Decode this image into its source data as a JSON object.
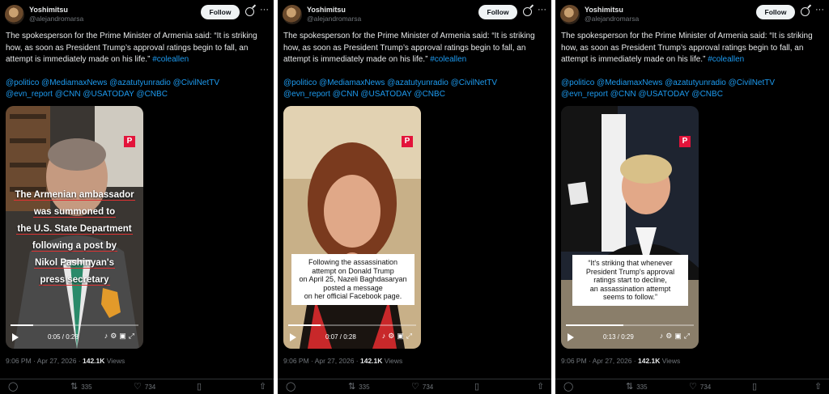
{
  "tweets": [
    {
      "author": {
        "name": "Yoshimitsu",
        "handle": "@alejandromarsa"
      },
      "follow_label": "Follow",
      "text": "The spokesperson for the Prime Minister of Armenia said: “It is striking how, as soon as President Trump’s approval ratings begin to fall, an attempt is immediately made on his life.”",
      "hashtag": "#coleallen",
      "mentions_line1": "@politico @MediamaxNews @azatutyunradio @CivilNetTV",
      "mentions_line2": "@evn_report @CNN @USATODAY @CNBC",
      "video": {
        "badge": "P",
        "caption_lines": [
          "The Armenian ambassador",
          "was summoned to",
          "the U.S. State Department",
          "following a post by",
          "Nikol Pashinyan's",
          "press secretary"
        ],
        "time": "0:05 / 0:28",
        "progress": 0.18
      },
      "timestamp": "9:06 PM · Apr 27, 2026 ·",
      "views_count": "142.1K",
      "views_label": "Views",
      "retweets": "335",
      "likes": "734"
    },
    {
      "author": {
        "name": "Yoshimitsu",
        "handle": "@alejandromarsa"
      },
      "follow_label": "Follow",
      "text": "The spokesperson for the Prime Minister of Armenia said: “It is striking how, as soon as President Trump’s approval ratings begin to fall, an attempt is immediately made on his life.”",
      "hashtag": "#coleallen",
      "mentions_line1": "@politico @MediamaxNews @azatutyunradio @CivilNetTV",
      "mentions_line2": "@evn_report @CNN @USATODAY @CNBC",
      "video": {
        "badge": "P",
        "caption_lines": [
          "Following the assassination",
          "attempt on Donald Trump",
          "on April 25, Nazeli Baghdasaryan",
          "posted a message",
          "on her official Facebook page."
        ],
        "time": "0:07 / 0:28",
        "progress": 0.25
      },
      "timestamp": "9:06 PM · Apr 27, 2026 ·",
      "views_count": "142.1K",
      "views_label": "Views",
      "retweets": "335",
      "likes": "734"
    },
    {
      "author": {
        "name": "Yoshimitsu",
        "handle": "@alejandromarsa"
      },
      "follow_label": "Follow",
      "text": "The spokesperson for the Prime Minister of Armenia said: “It is striking how, as soon as President Trump’s approval ratings begin to fall, an attempt is immediately made on his life.”",
      "hashtag": "#coleallen",
      "mentions_line1": "@politico @MediamaxNews @azatutyunradio @CivilNetTV",
      "mentions_line2": "@evn_report @CNN @USATODAY @CNBC",
      "video": {
        "badge": "P",
        "caption_lines": [
          "“It's striking that whenever",
          "President Trump's approval",
          "ratings start to decline,",
          "an assassination attempt",
          "seems to follow.”"
        ],
        "time": "0:13 / 0:29",
        "progress": 0.45
      },
      "timestamp": "9:06 PM · Apr 27, 2026 ·",
      "views_count": "142.1K",
      "views_label": "Views",
      "retweets": "335",
      "likes": "734"
    }
  ],
  "colors": {
    "background": "#000000",
    "link": "#1d9bf0",
    "muted": "#71767b",
    "badge": "#e3133a"
  },
  "icons": [
    "grok-icon",
    "more-icon",
    "play-icon",
    "volume-icon",
    "settings-icon",
    "pip-icon",
    "fullscreen-icon",
    "reply-icon",
    "retweet-icon",
    "like-icon",
    "bookmark-icon",
    "share-icon"
  ]
}
